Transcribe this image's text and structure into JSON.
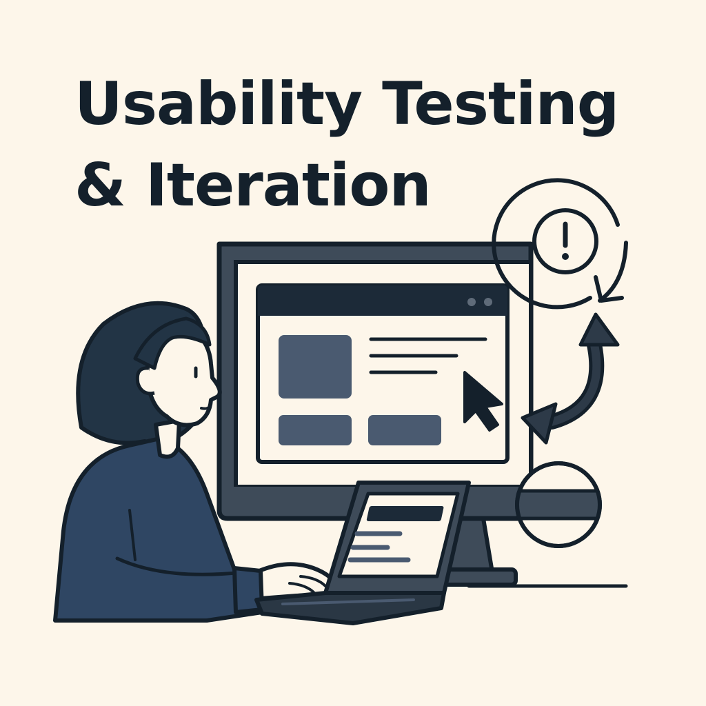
{
  "title": {
    "line1": "Usability Testing",
    "line2": "& Iteration"
  },
  "colors": {
    "background": "#fdf6ea",
    "ink": "#14202b",
    "navy": "#2f4663",
    "slate": "#3e4b59",
    "slate_light": "#4a5a70"
  },
  "icons": [
    "alert-cycle-icon",
    "cursor-icon",
    "feedback-arrow-icon"
  ]
}
